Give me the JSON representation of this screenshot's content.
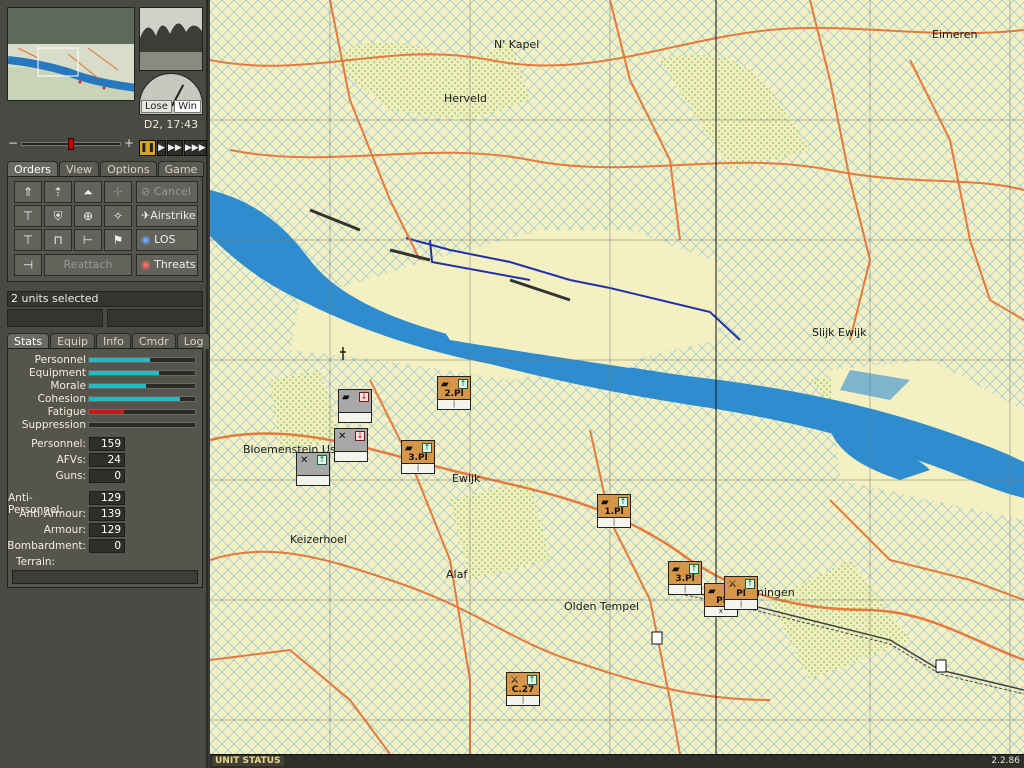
{
  "gauge": {
    "lose_label": "Lose",
    "win_label": "Win"
  },
  "clock": "D2, 17:43",
  "timeline": {
    "minus": "−",
    "plus": "+",
    "position": 0.5
  },
  "speed": [
    {
      "label": "❚❚",
      "active": true
    },
    {
      "label": "▶"
    },
    {
      "label": "▶▶"
    },
    {
      "label": "▶▶▶"
    }
  ],
  "orders_tabs": [
    "Orders",
    "View",
    "Options",
    "Game"
  ],
  "orders_icons": [
    "move-fast-icon",
    "move-icon",
    "hunt-icon",
    "target-icon",
    "assault-icon",
    "defend-icon",
    "shoot-icon",
    "deploy-icon",
    "dismount-icon",
    "mount-icon",
    "halt-icon",
    "rally-icon",
    "split-icon"
  ],
  "order_buttons": {
    "cancel": "Cancel",
    "airstrike": "Airstrike",
    "los": "LOS",
    "threats": "Threats",
    "reattach": "Reattach"
  },
  "selection": "2 units selected",
  "stats_tabs": [
    "Stats",
    "Equip",
    "Info",
    "Cmdr",
    "Log"
  ],
  "bars": [
    {
      "label": "Personnel",
      "value": 0.58,
      "color": "#29b7c8"
    },
    {
      "label": "Equipment",
      "value": 0.66,
      "color": "#29b7c8"
    },
    {
      "label": "Morale",
      "value": 0.54,
      "color": "#29b7c8"
    },
    {
      "label": "Cohesion",
      "value": 0.86,
      "color": "#29b7c8"
    },
    {
      "label": "Fatigue",
      "value": 0.33,
      "color": "#c81818"
    },
    {
      "label": "Suppression",
      "value": 0.0,
      "color": "#29b7c8"
    }
  ],
  "numbers": [
    {
      "label": "Personnel:",
      "value": "159"
    },
    {
      "label": "AFVs:",
      "value": "24"
    },
    {
      "label": "Guns:",
      "value": "0"
    },
    {
      "label": "Anti-Personnel:",
      "value": "129"
    },
    {
      "label": "Anti-Armour:",
      "value": "139"
    },
    {
      "label": "Armour:",
      "value": "129"
    },
    {
      "label": "Bombardment:",
      "value": "0"
    }
  ],
  "terrain_label": "Terrain:",
  "towns": [
    {
      "name": "N' Kapel"
    },
    {
      "name": "Eimeren"
    },
    {
      "name": "Herveld"
    },
    {
      "name": "Slijk Ewijk"
    },
    {
      "name": "Bloemenstein Us"
    },
    {
      "name": "Ewijk"
    },
    {
      "name": "Keizerhoel"
    },
    {
      "name": "Alaf"
    },
    {
      "name": "Olden Tempel"
    },
    {
      "name": "uningen"
    }
  ],
  "units": [
    {
      "name": "2.Pl",
      "type": "tank-icon",
      "side": "allied"
    },
    {
      "name": "3.Pl",
      "type": "tank-icon",
      "side": "allied"
    },
    {
      "name": "1.Pl",
      "type": "tank-icon",
      "side": "allied"
    },
    {
      "name": "3.Pl",
      "type": "tank-icon",
      "side": "allied"
    },
    {
      "name": "Pl",
      "type": "tank-icon",
      "side": "allied"
    },
    {
      "name": "Pl",
      "type": "artillery-icon",
      "side": "allied"
    },
    {
      "name": "C.27",
      "type": "artillery-icon",
      "side": "allied"
    },
    {
      "name": "",
      "type": "tank-icon",
      "side": "stack"
    },
    {
      "name": "",
      "type": "infantry-icon",
      "side": "stack"
    },
    {
      "name": "",
      "type": "infantry-icon",
      "side": "stack"
    }
  ],
  "status_bar": {
    "label": "UNIT STATUS",
    "version": "2.2.86"
  }
}
